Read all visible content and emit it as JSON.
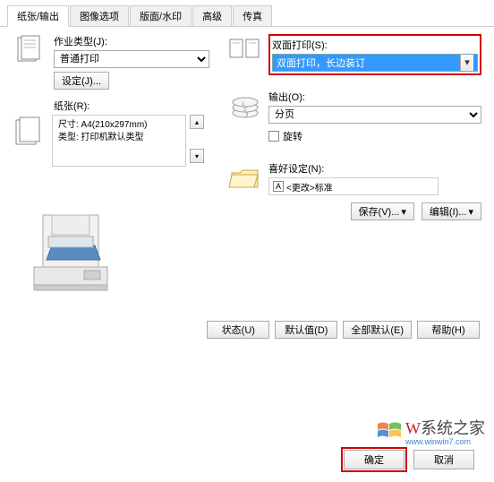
{
  "tabs": {
    "t0": "纸张/输出",
    "t1": "图像选项",
    "t2": "版面/水印",
    "t3": "高级",
    "t4": "传真"
  },
  "jobType": {
    "label": "作业类型(J):",
    "value": "普通打印",
    "settings": "设定(J)..."
  },
  "paper": {
    "label": "纸张(R):",
    "size": "尺寸: A4(210x297mm)",
    "type": "类型: 打印机默认类型"
  },
  "duplex": {
    "label": "双面打印(S):",
    "value": "双面打印，长边装订"
  },
  "output": {
    "label": "输出(O):",
    "value": "分页",
    "rotate": "旋转"
  },
  "pref": {
    "label": "喜好设定(N):",
    "value": "<更改>标准",
    "a": "A",
    "save": "保存(V)...",
    "edit": "编辑(I)..."
  },
  "bottom": {
    "status": "状态(U)",
    "defaults": "默认值(D)",
    "allDefaults": "全部默认(E)",
    "help": "帮助(H)"
  },
  "dialog": {
    "ok": "确定",
    "cancel": "取消"
  },
  "watermark": {
    "text1": "W",
    "text2": "系统之家",
    "sub": "www.winwin7.com"
  }
}
